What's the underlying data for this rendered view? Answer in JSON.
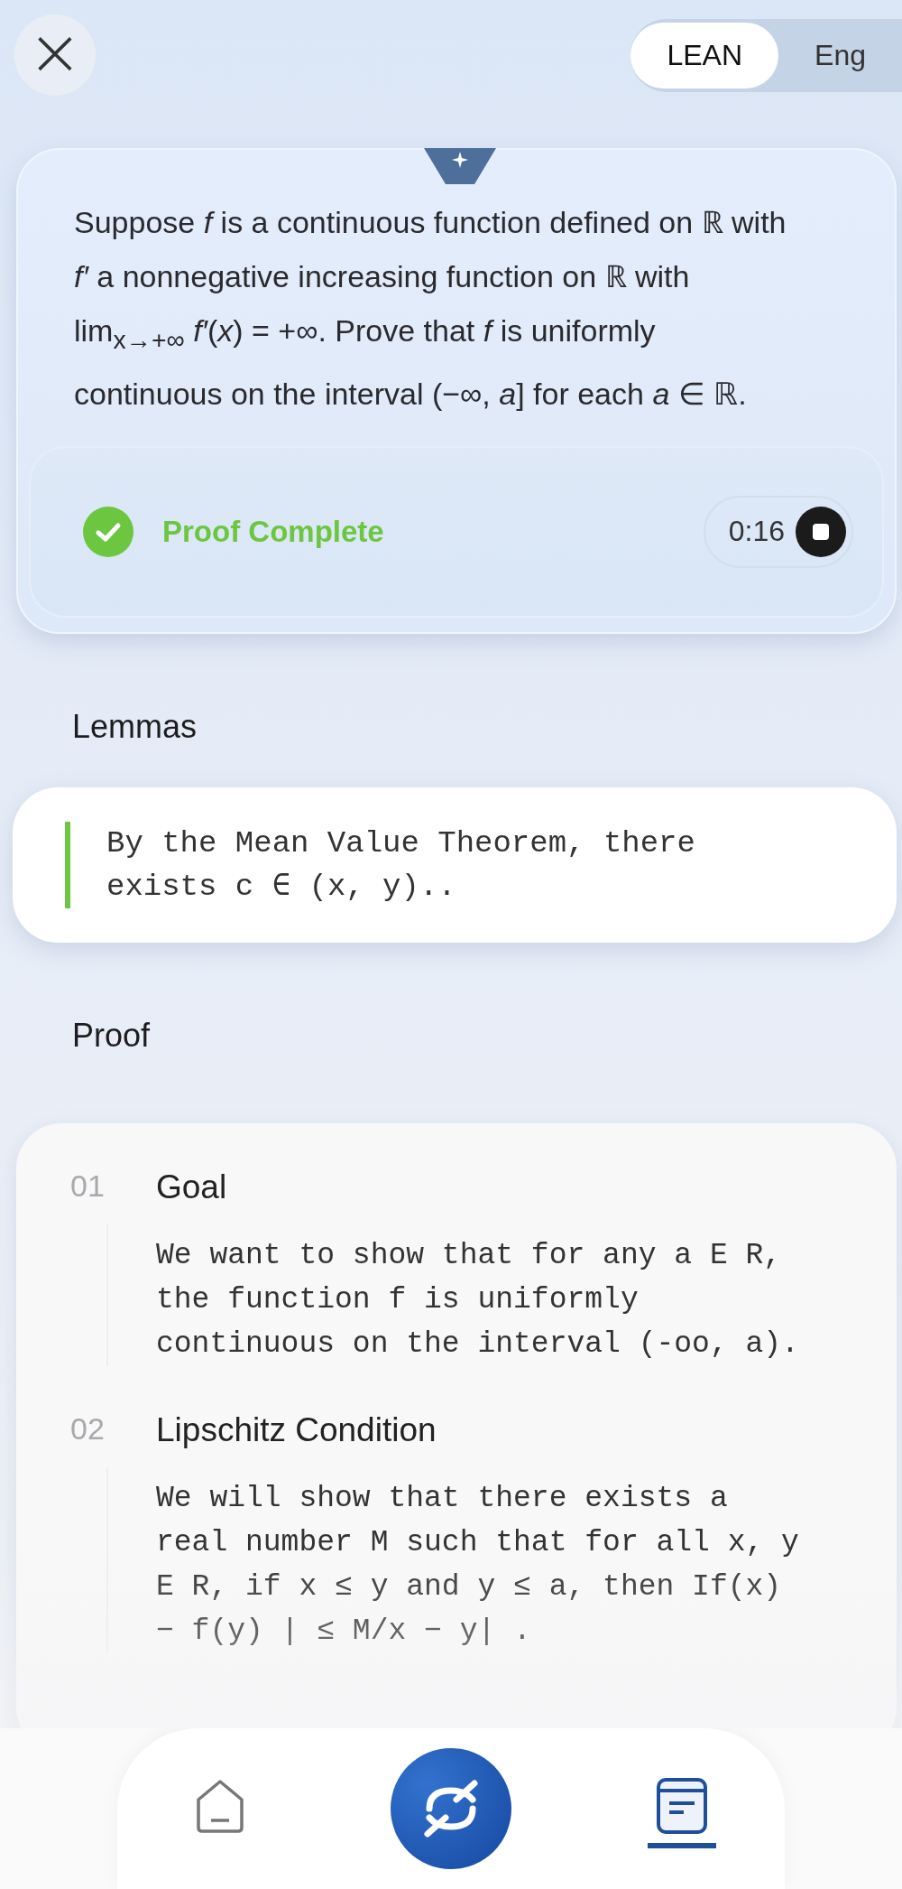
{
  "close_button": {
    "label": "×"
  },
  "language_toggle": [
    {
      "label": "LEAN",
      "selected": true
    },
    {
      "label": "Eng",
      "selected": false
    }
  ],
  "problem": {
    "text": "Suppose *f* is a continuous function defined on ℝ with *f′* a nonnegative increasing function on ℝ with lim$_{x→+∞}$ *f′*(*x*) = +∞. Prove that *f* is uniformly continuous on the interval (−∞, *a*] for each *a* ∈ ℝ.",
    "status": {
      "kind": "complete",
      "label": "Proof Complete"
    },
    "timer": "0:16"
  },
  "lemmas": {
    "title": "Lemmas",
    "items": [
      "By the Mean Value Theorem, there exists c ∈ (x, y).."
    ]
  },
  "proof": {
    "title": "Proof",
    "steps": [
      {
        "number": "01",
        "title": "Goal",
        "text": "We want to show that for any a E R, the function f is uniformly continuous on the interval (-oo, a)."
      },
      {
        "number": "02",
        "title": "Lipschitz Condition",
        "text": "We will show that there exists a real number M such that for all x, y E R, if x ≤ y and y ≤ a, then If(x) − f(y) | ≤ M/x − y| ."
      }
    ]
  },
  "nav": [
    {
      "kind": "home",
      "selected": false
    },
    {
      "kind": "center",
      "selected": false
    },
    {
      "kind": "notes",
      "selected": true
    }
  ]
}
